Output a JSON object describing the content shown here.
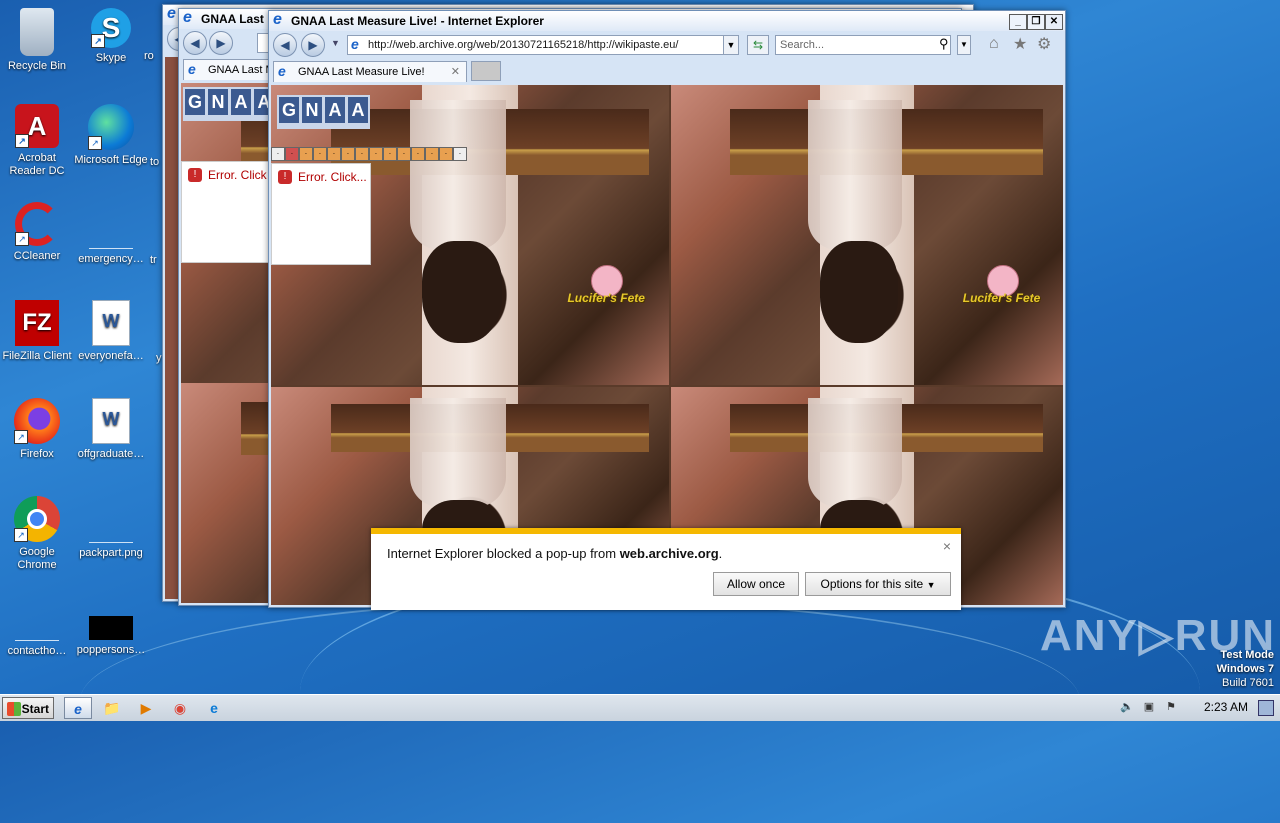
{
  "desktop": {
    "icons": [
      {
        "label": "Recycle Bin",
        "icon": "recycle-bin-icon",
        "glyph": "🗑"
      },
      {
        "label": "Skype",
        "icon": "skype-icon",
        "glyph": "S"
      },
      {
        "label": "ro",
        "icon": "partial-icon",
        "glyph": ""
      },
      {
        "label": "Acrobat Reader DC",
        "icon": "acrobat-icon",
        "glyph": "A"
      },
      {
        "label": "Microsoft Edge",
        "icon": "edge-icon",
        "glyph": "e"
      },
      {
        "label": "to",
        "icon": "partial-icon",
        "glyph": ""
      },
      {
        "label": "CCleaner",
        "icon": "ccleaner-icon",
        "glyph": "C"
      },
      {
        "label": "emergency…",
        "icon": "blank-file-icon",
        "glyph": ""
      },
      {
        "label": "tr",
        "icon": "partial-icon",
        "glyph": ""
      },
      {
        "label": "FileZilla Client",
        "icon": "filezilla-icon",
        "glyph": "FZ"
      },
      {
        "label": "everyonefa…",
        "icon": "word-doc-icon",
        "glyph": "W"
      },
      {
        "label": "y",
        "icon": "partial-icon",
        "glyph": ""
      },
      {
        "label": "Firefox",
        "icon": "firefox-icon",
        "glyph": "🦊"
      },
      {
        "label": "offgraduate…",
        "icon": "word-doc-icon",
        "glyph": "W"
      },
      {
        "label": "Google Chrome",
        "icon": "chrome-icon",
        "glyph": "⬤"
      },
      {
        "label": "packpart.png",
        "icon": "image-file-icon",
        "glyph": ""
      },
      {
        "label": "contactho…",
        "icon": "blank-file-icon",
        "glyph": ""
      },
      {
        "label": "poppersons…",
        "icon": "black-file-icon",
        "glyph": ""
      }
    ]
  },
  "browser": {
    "title": "GNAA Last Measure Live! - Internet Explorer",
    "back_title": "GNAA Last M",
    "address": "http://web.archive.org/web/20130721165218/http://wikipaste.eu/",
    "search_placeholder": "Search...",
    "tab_label": "GNAA Last Measure Live!",
    "back_tab_label": "GNAA Last M",
    "page": {
      "gnaa_letters": [
        "G",
        "N",
        "A",
        "A"
      ],
      "error_text": "Error. Click...",
      "back_error_text": "Error. Click",
      "logo_text": "Lucifer's Fete"
    }
  },
  "popup_blocker": {
    "message_prefix": "Internet Explorer blocked a pop-up from ",
    "domain": "web.archive.org",
    "message_suffix": ".",
    "allow_once": "Allow once",
    "options": "Options for this site",
    "close": "×"
  },
  "watermark": {
    "text": "ANY▷RUN"
  },
  "test_mode": {
    "line1": "Test Mode",
    "line2": "Windows 7",
    "line3": "Build 7601"
  },
  "taskbar": {
    "start": "Start",
    "clock": "2:23 AM",
    "pinned": [
      {
        "name": "taskbar-ie-icon",
        "glyph": "e"
      },
      {
        "name": "taskbar-explorer-icon",
        "glyph": "📁"
      },
      {
        "name": "taskbar-media-player-icon",
        "glyph": "▶"
      },
      {
        "name": "taskbar-chrome-icon",
        "glyph": "◉"
      },
      {
        "name": "taskbar-edge-icon",
        "glyph": "e"
      }
    ]
  }
}
